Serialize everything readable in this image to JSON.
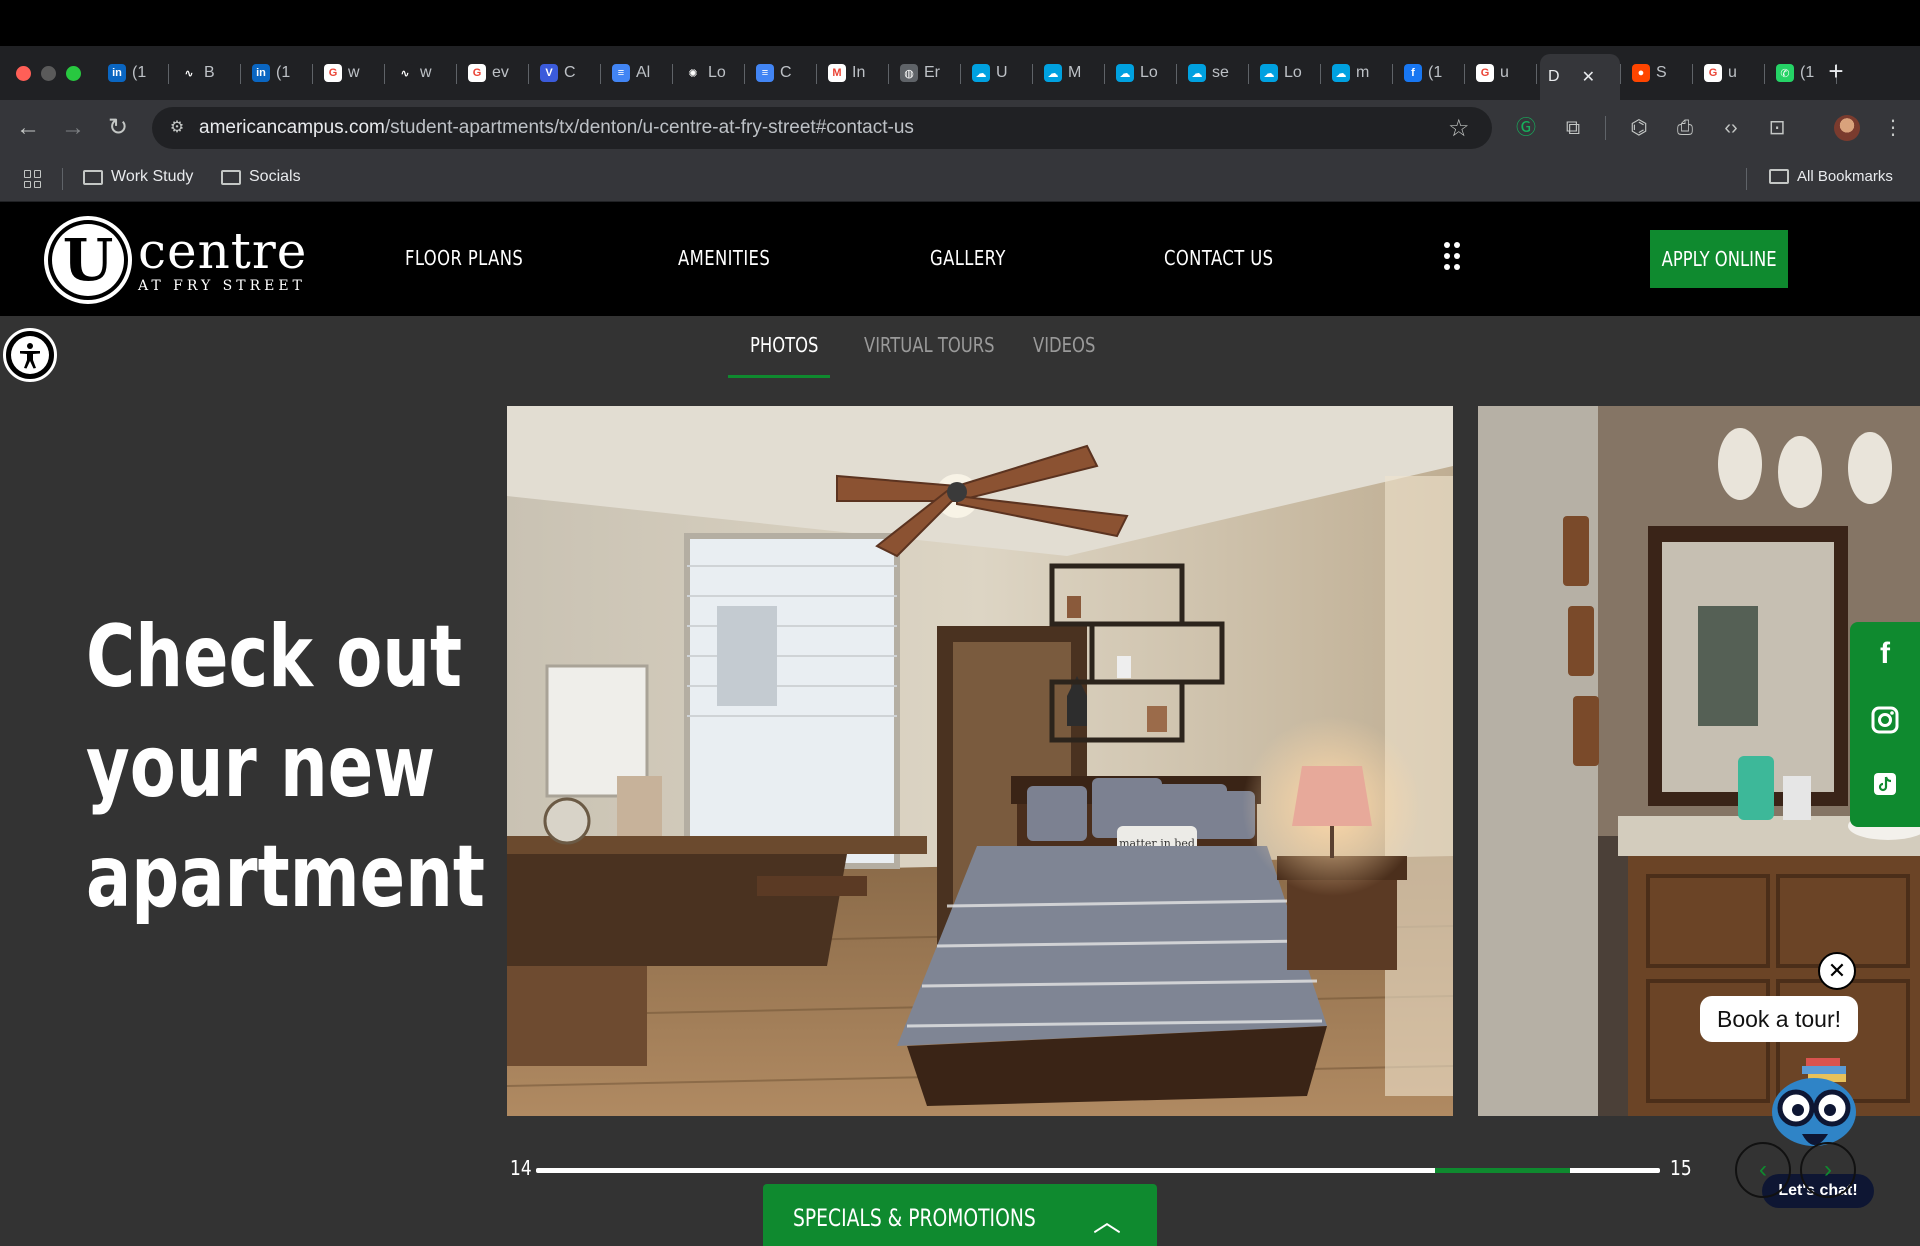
{
  "browser": {
    "tabs": [
      {
        "icon": "linkedin-icon",
        "label": "(1",
        "color": "#0a66c2",
        "glyph": "in"
      },
      {
        "icon": "signature-icon",
        "label": "B",
        "color": "#202124",
        "glyph": "∿"
      },
      {
        "icon": "linkedin-icon",
        "label": "(1",
        "color": "#0a66c2",
        "glyph": "in"
      },
      {
        "icon": "google-icon",
        "label": "w",
        "color": "#ffffff",
        "glyph": "G"
      },
      {
        "icon": "signature-icon",
        "label": "w",
        "color": "#202124",
        "glyph": "∿"
      },
      {
        "icon": "google-icon",
        "label": "ev",
        "color": "#ffffff",
        "glyph": "G"
      },
      {
        "icon": "chevron-brand-icon",
        "label": "C",
        "color": "#3b5bdb",
        "glyph": "V"
      },
      {
        "icon": "docs-icon",
        "label": "Al",
        "color": "#4285f4",
        "glyph": "≡"
      },
      {
        "icon": "openai-icon",
        "label": "Lo",
        "color": "#202124",
        "glyph": "✺"
      },
      {
        "icon": "docs-icon",
        "label": "C",
        "color": "#4285f4",
        "glyph": "≡"
      },
      {
        "icon": "gmail-icon",
        "label": "In",
        "color": "#ffffff",
        "glyph": "M"
      },
      {
        "icon": "globe-icon",
        "label": "Er",
        "color": "#5f6368",
        "glyph": "◍"
      },
      {
        "icon": "salesforce-icon",
        "label": "U",
        "color": "#00a1e0",
        "glyph": "☁"
      },
      {
        "icon": "salesforce-icon",
        "label": "M",
        "color": "#00a1e0",
        "glyph": "☁"
      },
      {
        "icon": "salesforce-icon",
        "label": "Lo",
        "color": "#00a1e0",
        "glyph": "☁"
      },
      {
        "icon": "salesforce-icon",
        "label": "se",
        "color": "#00a1e0",
        "glyph": "☁"
      },
      {
        "icon": "salesforce-icon",
        "label": "Lo",
        "color": "#00a1e0",
        "glyph": "☁"
      },
      {
        "icon": "salesforce-icon",
        "label": "m",
        "color": "#00a1e0",
        "glyph": "☁"
      },
      {
        "icon": "facebook-icon",
        "label": "(1",
        "color": "#1877f2",
        "glyph": "f"
      },
      {
        "icon": "google-icon",
        "label": "u",
        "color": "#ffffff",
        "glyph": "G"
      }
    ],
    "active_tab": {
      "label": "D"
    },
    "tabs_after": [
      {
        "icon": "reddit-icon",
        "label": "S",
        "color": "#ff4500",
        "glyph": "●"
      },
      {
        "icon": "google-icon",
        "label": "u",
        "color": "#ffffff",
        "glyph": "G"
      },
      {
        "icon": "whatsapp-icon",
        "label": "(1",
        "color": "#25d366",
        "glyph": "✆"
      }
    ],
    "url_host": "americancampus.com",
    "url_path": "/student-apartments/tx/denton/u-centre-at-fry-street#contact-us",
    "bookmarks": [
      {
        "label": "Work Study"
      },
      {
        "label": "Socials"
      }
    ],
    "all_bookmarks": "All Bookmarks"
  },
  "site": {
    "logo_word": "centre",
    "logo_letter": "U",
    "logo_sub": "AT FRY STREET",
    "nav": [
      {
        "label": "FLOOR PLANS"
      },
      {
        "label": "AMENITIES"
      },
      {
        "label": "GALLERY"
      },
      {
        "label": "CONTACT US"
      }
    ],
    "apply_label": "APPLY ONLINE",
    "gallery_tabs": [
      {
        "label": "PHOTOS",
        "active": true
      },
      {
        "label": "VIRTUAL TOURS",
        "active": false
      },
      {
        "label": "VIDEOS",
        "active": false
      }
    ],
    "headline": [
      "Check out",
      "your new",
      "apartment"
    ],
    "photo_pillow_text": "matter in bed",
    "slider": {
      "current": "14",
      "next": "15",
      "progress_start": 0.8,
      "progress_end": 0.92
    },
    "book_tour": "Book a tour!",
    "chat": "Let's chat!",
    "specials": "SPECIALS & PROMOTIONS",
    "colors": {
      "brand_green": "#0f8a2f",
      "page_bg": "#333333",
      "header_bg": "#000000"
    }
  }
}
